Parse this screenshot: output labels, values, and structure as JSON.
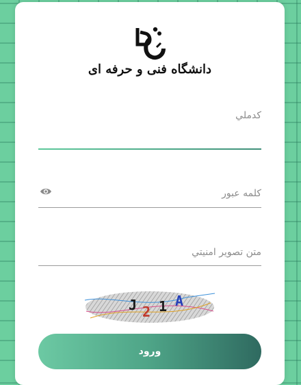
{
  "logo": {
    "text": "دانشگاه فنی و حرفه ای"
  },
  "form": {
    "username_placeholder": "كدملي",
    "password_placeholder": "كلمه عبور",
    "captcha_placeholder": "متن تصوير امنيتي",
    "captcha_chars": [
      "J",
      "2",
      "1",
      "A"
    ]
  },
  "login_label": "ورود",
  "colors": {
    "accent_start": "#6cc9a3",
    "accent_end": "#2f6a60",
    "background": "#6ccf9f"
  }
}
